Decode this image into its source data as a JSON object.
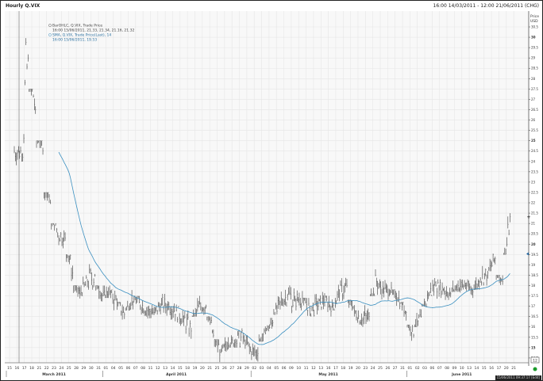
{
  "header": {
    "title": "Hourly Q.VIX",
    "range": "16:00 14/03/2011 - 12:00 21/06/2011 (CHG)"
  },
  "legend": {
    "bar_series": "BarOHLC, Q.VIX, Trade Price",
    "bar_values": "16:00 15/06/2011, 21.33, 21.34, 21.16, 21.32",
    "sma_series": "SMA, Q.VIX, Trade Price(Last), 14",
    "sma_values": "16:00 15/06/2011, 19.53"
  },
  "axis": {
    "price_label": "Price",
    "currency_label": "USD",
    "zoom_box": "12"
  },
  "status": {
    "text": "15/06/2011 09:37:17 [Edit]"
  },
  "colors": {
    "bars": "#555555",
    "sma": "#3a8fc0",
    "grid": "#e6e6e6",
    "live_dot": "#1a9a2a"
  },
  "chart_data": {
    "type": "line",
    "title": "Hourly Q.VIX",
    "ylabel": "Price USD",
    "ylim": [
      14.25,
      30.75
    ],
    "yticks": [
      "30.5",
      "30",
      "29.5",
      "29",
      "28.5",
      "28",
      "27.5",
      "27",
      "26.5",
      "26",
      "25.5",
      "25",
      "24.5",
      "24",
      "23.5",
      "23",
      "22.5",
      "22",
      "21.5",
      "21",
      "20.5",
      "20",
      "19.5",
      "19",
      "18.5",
      "18",
      "17.5",
      "17",
      "16.5",
      "16",
      "15.5",
      "15",
      "14.5"
    ],
    "xticks": [
      "15",
      "16",
      "17",
      "18",
      "21",
      "22",
      "23",
      "24",
      "25",
      "28",
      "29",
      "30",
      "31",
      "01",
      "04",
      "05",
      "06",
      "07",
      "08",
      "11",
      "12",
      "13",
      "14",
      "15",
      "18",
      "19",
      "20",
      "21",
      "25",
      "26",
      "27",
      "28",
      "29",
      "02",
      "03",
      "04",
      "05",
      "06",
      "09",
      "10",
      "11",
      "12",
      "13",
      "16",
      "17",
      "18",
      "19",
      "20",
      "23",
      "24",
      "25",
      "26",
      "27",
      "31",
      "01",
      "02",
      "03",
      "06",
      "07",
      "08",
      "09",
      "10",
      "13",
      "14",
      "15",
      "16",
      "17",
      "20",
      "21"
    ],
    "months": [
      {
        "label": "March 2011",
        "start": 0,
        "end": 12
      },
      {
        "label": "April 2011",
        "start": 13,
        "end": 32
      },
      {
        "label": "May 2011",
        "start": 33,
        "end": 53
      },
      {
        "label": "June 2011",
        "start": 54,
        "end": 68
      }
    ],
    "series": [
      {
        "name": "BarOHLC, Q.VIX, Trade Price",
        "type": "ohlc-daily-summary",
        "close": [
          24.5,
          29,
          26.5,
          24.5,
          22,
          20.5,
          20.3,
          18.6,
          17.6,
          18.2,
          18.5,
          17.5,
          17.7,
          17.2,
          16.6,
          17.4,
          17.2,
          16.8,
          16.7,
          17.1,
          17.0,
          16.8,
          16.4,
          15.8,
          17.0,
          17.0,
          15.6,
          14.8,
          15.2,
          15.3,
          15.5,
          14.9,
          14.7,
          15.7,
          16.2,
          17.2,
          17.5,
          17.3,
          17.4,
          16.9,
          17.0,
          17.3,
          17.0,
          17.6,
          18.0,
          16.8,
          16.3,
          16.5,
          18.2,
          17.7,
          17.9,
          17.4,
          16.7,
          15.6,
          16.5,
          17.5,
          18.0,
          17.8,
          17.6,
          18.0,
          18.0,
          17.7,
          18.3,
          18.6,
          19.3,
          18.2,
          21.32
        ],
        "high": [
          25.5,
          31,
          27.5,
          25,
          22.5,
          21,
          21,
          19.5,
          18,
          18.5,
          19.8,
          18,
          18,
          17.8,
          17.2,
          17.8,
          17.5,
          17.5,
          17.2,
          17.4,
          17.6,
          17.3,
          17,
          16.8,
          18,
          17.5,
          16.5,
          15.4,
          15.5,
          15.6,
          16.4,
          15.6,
          15.2,
          16.2,
          16.8,
          17.8,
          18.5,
          18.8,
          18.1,
          17.4,
          18,
          17.8,
          17.5,
          18.3,
          18.5,
          17.3,
          16.8,
          17.4,
          19.6,
          18.3,
          18.3,
          17.8,
          17.2,
          16.1,
          17.3,
          18.5,
          19.5,
          18.3,
          18.2,
          18.4,
          18.5,
          18.3,
          18.8,
          19.3,
          19.8,
          18.5,
          21.5
        ],
        "low": [
          23.8,
          24,
          25.5,
          23,
          21,
          20,
          19.8,
          18,
          17,
          17.5,
          17.8,
          17,
          17.4,
          16.6,
          16.3,
          16.8,
          16.6,
          16.5,
          16.4,
          16.6,
          16.4,
          16.2,
          15.7,
          15.3,
          16.5,
          16.5,
          15.2,
          14.3,
          14.8,
          15,
          15,
          14.6,
          14.3,
          15.3,
          15.8,
          16.6,
          17,
          16.6,
          16.8,
          16.4,
          16.5,
          16.8,
          16.5,
          16.8,
          17.2,
          16.3,
          15.8,
          16,
          17.5,
          17.2,
          17.3,
          17,
          16.2,
          15.2,
          16,
          17,
          17.5,
          17.3,
          17.3,
          17.7,
          17.6,
          17.4,
          17.8,
          18,
          18.5,
          17.8,
          19.5
        ]
      },
      {
        "name": "SMA, Q.VIX, Trade Price(Last), 14",
        "type": "sma",
        "period": 14,
        "last": 19.53
      }
    ],
    "last_values": {
      "bar": 21.32,
      "sma": 19.53
    },
    "grid": true
  }
}
